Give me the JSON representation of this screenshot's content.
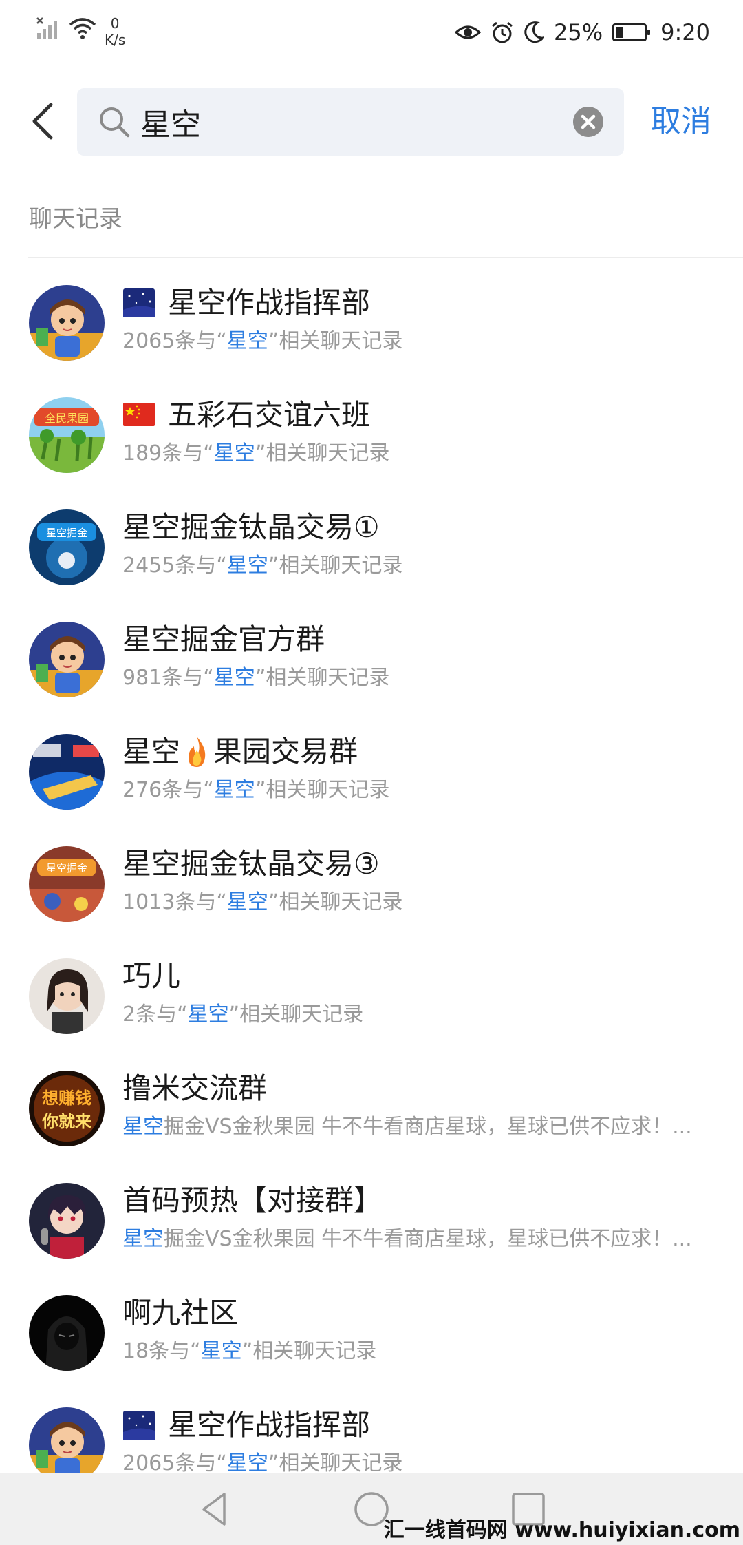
{
  "status_bar": {
    "speed_value": "0",
    "speed_unit": "K/s",
    "battery": "25%",
    "battery_level": 0.25,
    "time": "9:20",
    "icons": [
      "signal-icon",
      "wifi-icon",
      "eye-icon",
      "alarm-icon",
      "moon-icon",
      "battery-icon"
    ]
  },
  "search": {
    "query": "星空",
    "cancel_label": "取消"
  },
  "section": {
    "title": "聊天记录"
  },
  "results": [
    {
      "flag": "night-sky",
      "title": "星空作战指挥部",
      "sub_pre": "2065条与“",
      "sub_hl": "星空",
      "sub_post": "”相关聊天记录",
      "avatar": "cartoon-boy"
    },
    {
      "flag": "china",
      "title": "五彩石交谊六班",
      "sub_pre": "189条与“",
      "sub_hl": "星空",
      "sub_post": "”相关聊天记录",
      "avatar": "orchard-game"
    },
    {
      "flag": "",
      "title": "星空掘金钛晶交易①",
      "sub_pre": "2455条与“",
      "sub_hl": "星空",
      "sub_post": "”相关聊天记录",
      "avatar": "blue-logo"
    },
    {
      "flag": "",
      "title": "星空掘金官方群",
      "sub_pre": "981条与“",
      "sub_hl": "星空",
      "sub_post": "”相关聊天记录",
      "avatar": "cartoon-boy"
    },
    {
      "flag": "",
      "title_a": "星空",
      "title_b": "果园交易群",
      "title": "",
      "sub_pre": "276条与“",
      "sub_hl": "星空",
      "sub_post": "”相关聊天记录",
      "avatar": "island-game"
    },
    {
      "flag": "",
      "title": "星空掘金钛晶交易③",
      "sub_pre": "1013条与“",
      "sub_hl": "星空",
      "sub_post": "”相关聊天记录",
      "avatar": "red-logo"
    },
    {
      "flag": "",
      "title": "巧儿",
      "sub_pre": "2条与“",
      "sub_hl": "星空",
      "sub_post": "”相关聊天记录",
      "avatar": "girl-photo"
    },
    {
      "flag": "",
      "title": "撸米交流群",
      "sub_pre": "",
      "sub_hl": "星空",
      "sub_post": "掘金VS金秋果园 牛不牛看商店星球，星球已供不应求！...",
      "avatar": "fire-text"
    },
    {
      "flag": "",
      "title": "首码预热【对接群】",
      "sub_pre": "",
      "sub_hl": "星空",
      "sub_post": "掘金VS金秋果园 牛不牛看商店星球，星球已供不应求！...",
      "avatar": "anime-singer"
    },
    {
      "flag": "",
      "title": "啊九社区",
      "sub_pre": "18条与“",
      "sub_hl": "星空",
      "sub_post": "”相关聊天记录",
      "avatar": "hooded-figure"
    },
    {
      "flag": "night-sky",
      "title": "星空作战指挥部",
      "sub_pre": "2065条与“",
      "sub_hl": "星空",
      "sub_post": "”相关聊天记录",
      "avatar": "cartoon-boy"
    }
  ],
  "watermark": "汇一线首码网 www.huiyixian.com",
  "colors": {
    "accent": "#2d7de0",
    "secondary_text": "#9a9a9a",
    "search_bg": "#eff2f7",
    "nav_bg": "#f0f0f0"
  }
}
